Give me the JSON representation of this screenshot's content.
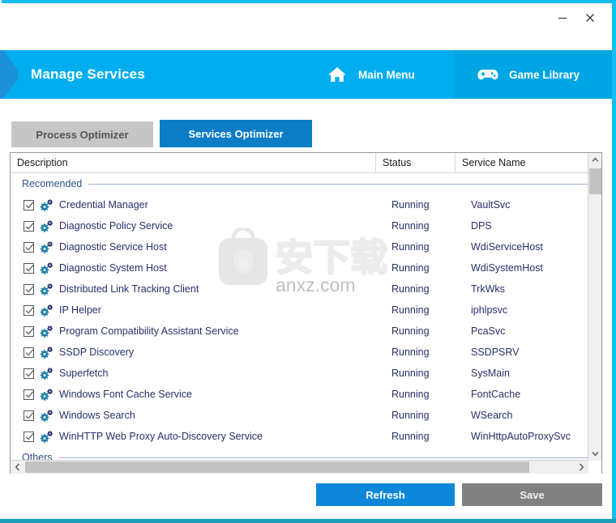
{
  "window": {
    "minimize_label": "−",
    "close_label": "✕",
    "minimize_icon": "minimize-icon",
    "close_icon": "close-icon"
  },
  "header": {
    "title": "Manage Services",
    "nav": [
      {
        "label": "Main Menu",
        "icon": "home-icon"
      },
      {
        "label": "Game Library",
        "icon": "gamepad-icon"
      }
    ],
    "accent_color": "#00aeef",
    "accent_alt_color": "#00a5e3"
  },
  "tabs": [
    {
      "label": "Process Optimizer",
      "active": false
    },
    {
      "label": "Services Optimizer",
      "active": true
    }
  ],
  "table": {
    "columns": [
      "Description",
      "Status",
      "Service Name"
    ],
    "groups": [
      {
        "label": "Recomended",
        "rows": [
          {
            "checked": true,
            "description": "Credential Manager",
            "status": "Running",
            "service_name": "VaultSvc"
          },
          {
            "checked": true,
            "description": "Diagnostic Policy Service",
            "status": "Running",
            "service_name": "DPS"
          },
          {
            "checked": true,
            "description": "Diagnostic Service Host",
            "status": "Running",
            "service_name": "WdiServiceHost"
          },
          {
            "checked": true,
            "description": "Diagnostic System Host",
            "status": "Running",
            "service_name": "WdiSystemHost"
          },
          {
            "checked": true,
            "description": "Distributed Link Tracking Client",
            "status": "Running",
            "service_name": "TrkWks"
          },
          {
            "checked": true,
            "description": "IP Helper",
            "status": "Running",
            "service_name": "iphlpsvc"
          },
          {
            "checked": true,
            "description": "Program Compatibility Assistant Service",
            "status": "Running",
            "service_name": "PcaSvc"
          },
          {
            "checked": true,
            "description": "SSDP Discovery",
            "status": "Running",
            "service_name": "SSDPSRV"
          },
          {
            "checked": true,
            "description": "Superfetch",
            "status": "Running",
            "service_name": "SysMain"
          },
          {
            "checked": true,
            "description": "Windows Font Cache Service",
            "status": "Running",
            "service_name": "FontCache"
          },
          {
            "checked": true,
            "description": "Windows Search",
            "status": "Running",
            "service_name": "WSearch"
          },
          {
            "checked": true,
            "description": "WinHTTP Web Proxy Auto-Discovery Service",
            "status": "Running",
            "service_name": "WinHttpAutoProxySvc"
          }
        ]
      },
      {
        "label": "Others",
        "rows": []
      }
    ]
  },
  "scrollbars": {
    "vertical": {
      "up_icon": "chevron-up-icon",
      "down_icon": "chevron-down-icon"
    },
    "horizontal": {
      "left_icon": "chevron-left-icon",
      "right_icon": "chevron-right-icon"
    }
  },
  "footer": {
    "refresh_label": "Refresh",
    "save_label": "Save",
    "refresh_color": "#0d87d9",
    "save_color": "#808080"
  },
  "watermark": {
    "text": "anxz.com",
    "chinese": "安下载",
    "shield_char": "安"
  }
}
